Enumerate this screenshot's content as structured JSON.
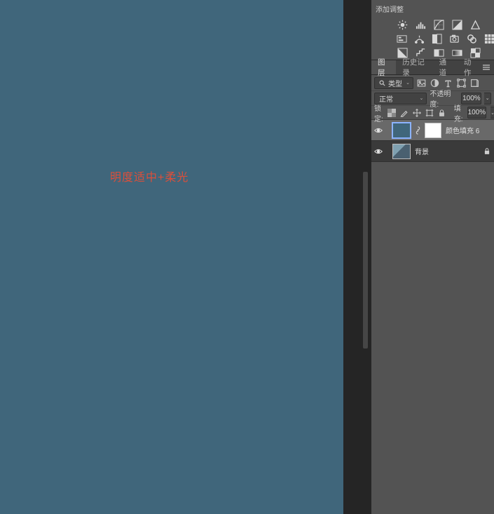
{
  "canvas": {
    "overlay_text": "明度适中+柔光"
  },
  "adjustments": {
    "title": "添加调整"
  },
  "panels": {
    "tabs": {
      "layers": "图层",
      "history": "历史记录",
      "channels": "通道",
      "actions": "动作"
    },
    "filter": {
      "kind": "类型"
    },
    "blend": {
      "mode": "正常",
      "opacity_label": "不透明度:",
      "opacity_value": "100%"
    },
    "lock": {
      "label": "锁定:",
      "fill_label": "填充:",
      "fill_value": "100%"
    },
    "layers_list": [
      {
        "name": "颜色填充 6"
      },
      {
        "name": "背景"
      }
    ]
  }
}
